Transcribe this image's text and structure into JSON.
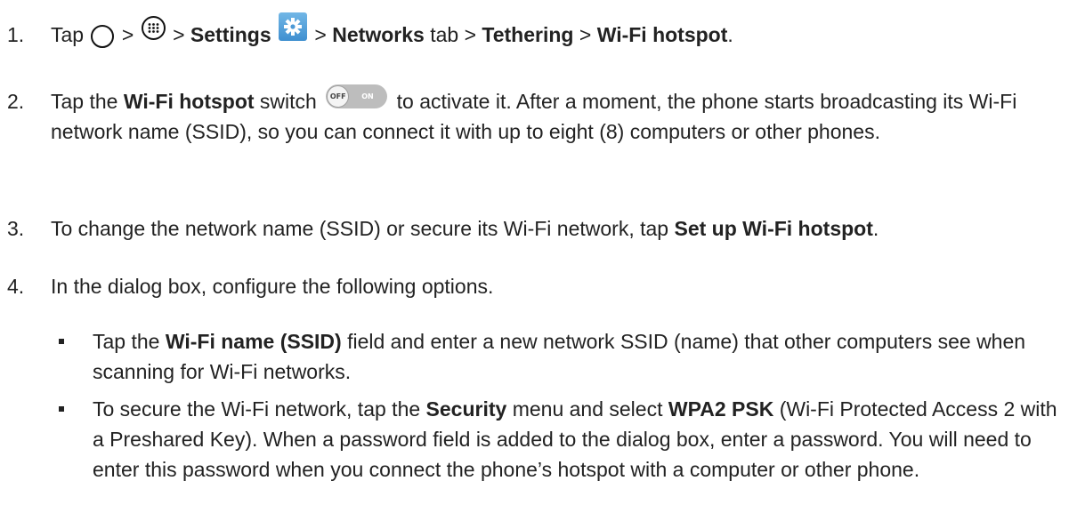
{
  "steps": [
    {
      "num": "1.",
      "t1": "Tap",
      "gt1": " > ",
      "gt2": " > ",
      "settings": "Settings",
      "gt3": " > ",
      "networks": "Networks",
      "tab": " tab > ",
      "tethering": "Tethering",
      "gt4": " > ",
      "hotspot": "Wi-Fi hotspot",
      "end": "."
    },
    {
      "num": "2.",
      "t1": "Tap the ",
      "b1": "Wi-Fi hotspot",
      "t2": " switch ",
      "t3": " to activate it. After a moment, the phone starts broadcasting its Wi-Fi network name (SSID), so you can connect it with up to eight (8) computers or other phones."
    },
    {
      "num": "3.",
      "t1": "To change the network name (SSID) or secure its Wi-Fi network, tap ",
      "b1": "Set up Wi-Fi hotspot",
      "end": "."
    },
    {
      "num": "4.",
      "t1": "In the dialog box, configure the following options."
    }
  ],
  "bullets": [
    {
      "t1": "Tap the ",
      "b1": "Wi-Fi name (SSID)",
      "t2": " field and enter a new network SSID (name) that other computers see when scanning for Wi-Fi networks."
    },
    {
      "t1": "To secure the Wi-Fi network, tap the ",
      "b1": "Security",
      "t2": " menu and select ",
      "b2": "WPA2 PSK",
      "t3": " (Wi-Fi Protected Access 2 with a Preshared Key). When a password field is added to the dialog box, enter a password. You will need to enter this password when you connect the phone’s hotspot with a computer or other phone."
    }
  ],
  "toggle": {
    "off_label": "OFF",
    "on_label": "ON"
  },
  "icons": {
    "home": "home-circle-icon",
    "apps": "apps-icon",
    "settings": "settings-gear-icon",
    "switch": "toggle-switch-icon"
  }
}
